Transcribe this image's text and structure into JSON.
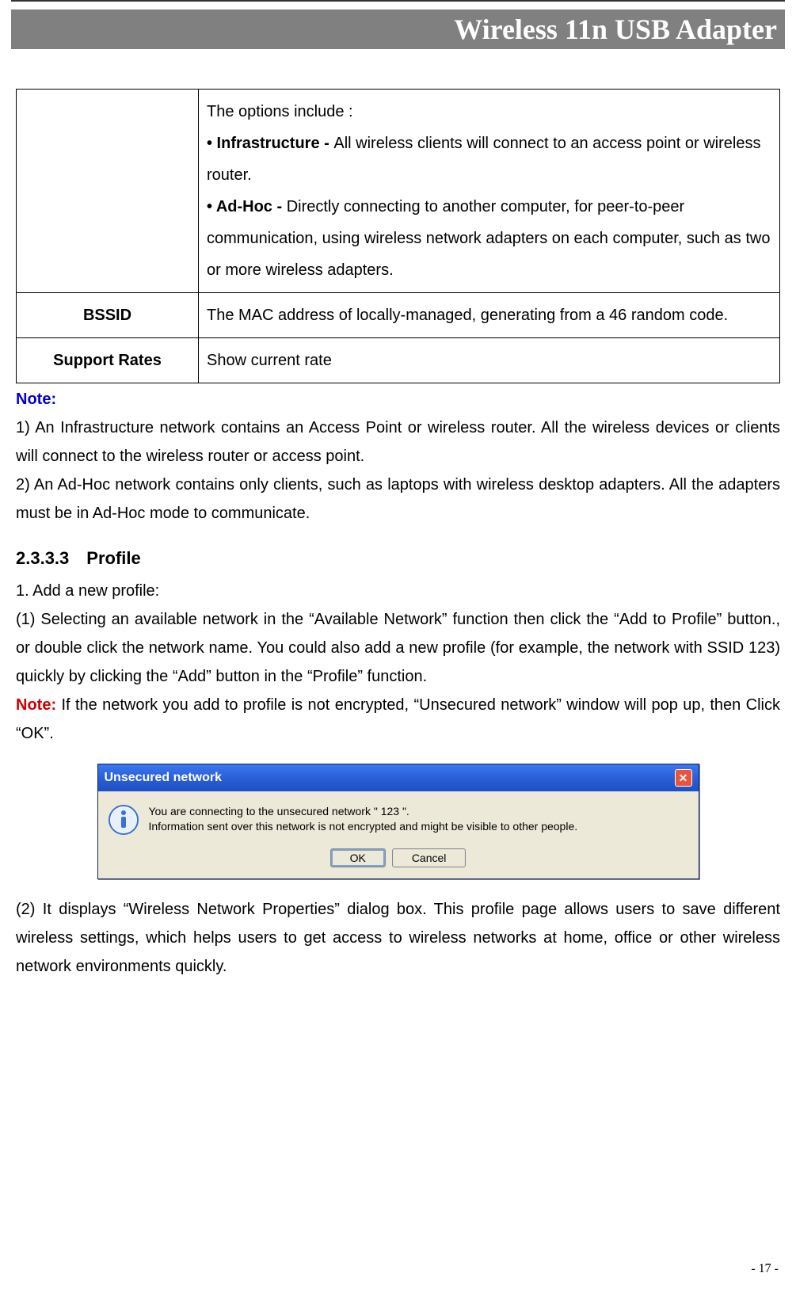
{
  "header": {
    "title": "Wireless 11n USB Adapter"
  },
  "table_rows": [
    {
      "label": "",
      "content_intro": "The options include :",
      "bullet1_label": "• Infrastructure - ",
      "bullet1_text": "All wireless clients will connect to an access point or wireless router.",
      "bullet2_label": "• Ad-Hoc - ",
      "bullet2_text": "Directly connecting to another computer, for peer-to-peer communication, using wireless network adapters on each computer, such as two or more wireless adapters."
    },
    {
      "label": "BSSID",
      "content": "The MAC address of locally-managed, generating from a 46 random code."
    },
    {
      "label": "Support Rates",
      "content": "Show current rate"
    }
  ],
  "notes": {
    "label": "Note:",
    "item1": "1) An Infrastructure network contains an Access Point or wireless router. All the wireless devices or clients will connect to the wireless router or access point.",
    "item2": "2) An Ad-Hoc network contains only clients, such as laptops with wireless desktop adapters. All the adapters must be in Ad-Hoc mode to communicate."
  },
  "section": {
    "heading": "2.3.3.3 Profile",
    "line1": "1. Add a new profile:",
    "line2": "(1) Selecting an available network in the “Available Network” function then click the “Add to Profile” button., or double click the network name. You could also add a new profile (for example, the network with SSID 123) quickly by clicking the “Add” button in the “Profile” function.",
    "note_label": "Note:",
    "note_text": " If the network you add to profile is not encrypted, “Unsecured network” window will pop up, then Click “OK”.",
    "line3": "(2) It displays “Wireless Network Properties” dialog box. This profile page allows users to save different wireless settings, which helps users to get access to wireless networks at home, office or other wireless network environments quickly."
  },
  "dialog": {
    "title": "Unsecured network",
    "msg_line1": "You are connecting to the unsecured network \" 123 \".",
    "msg_line2": "Information sent over this network is not encrypted and might be visible to other people.",
    "ok": "OK",
    "cancel": "Cancel"
  },
  "page_number": "- 17 -"
}
